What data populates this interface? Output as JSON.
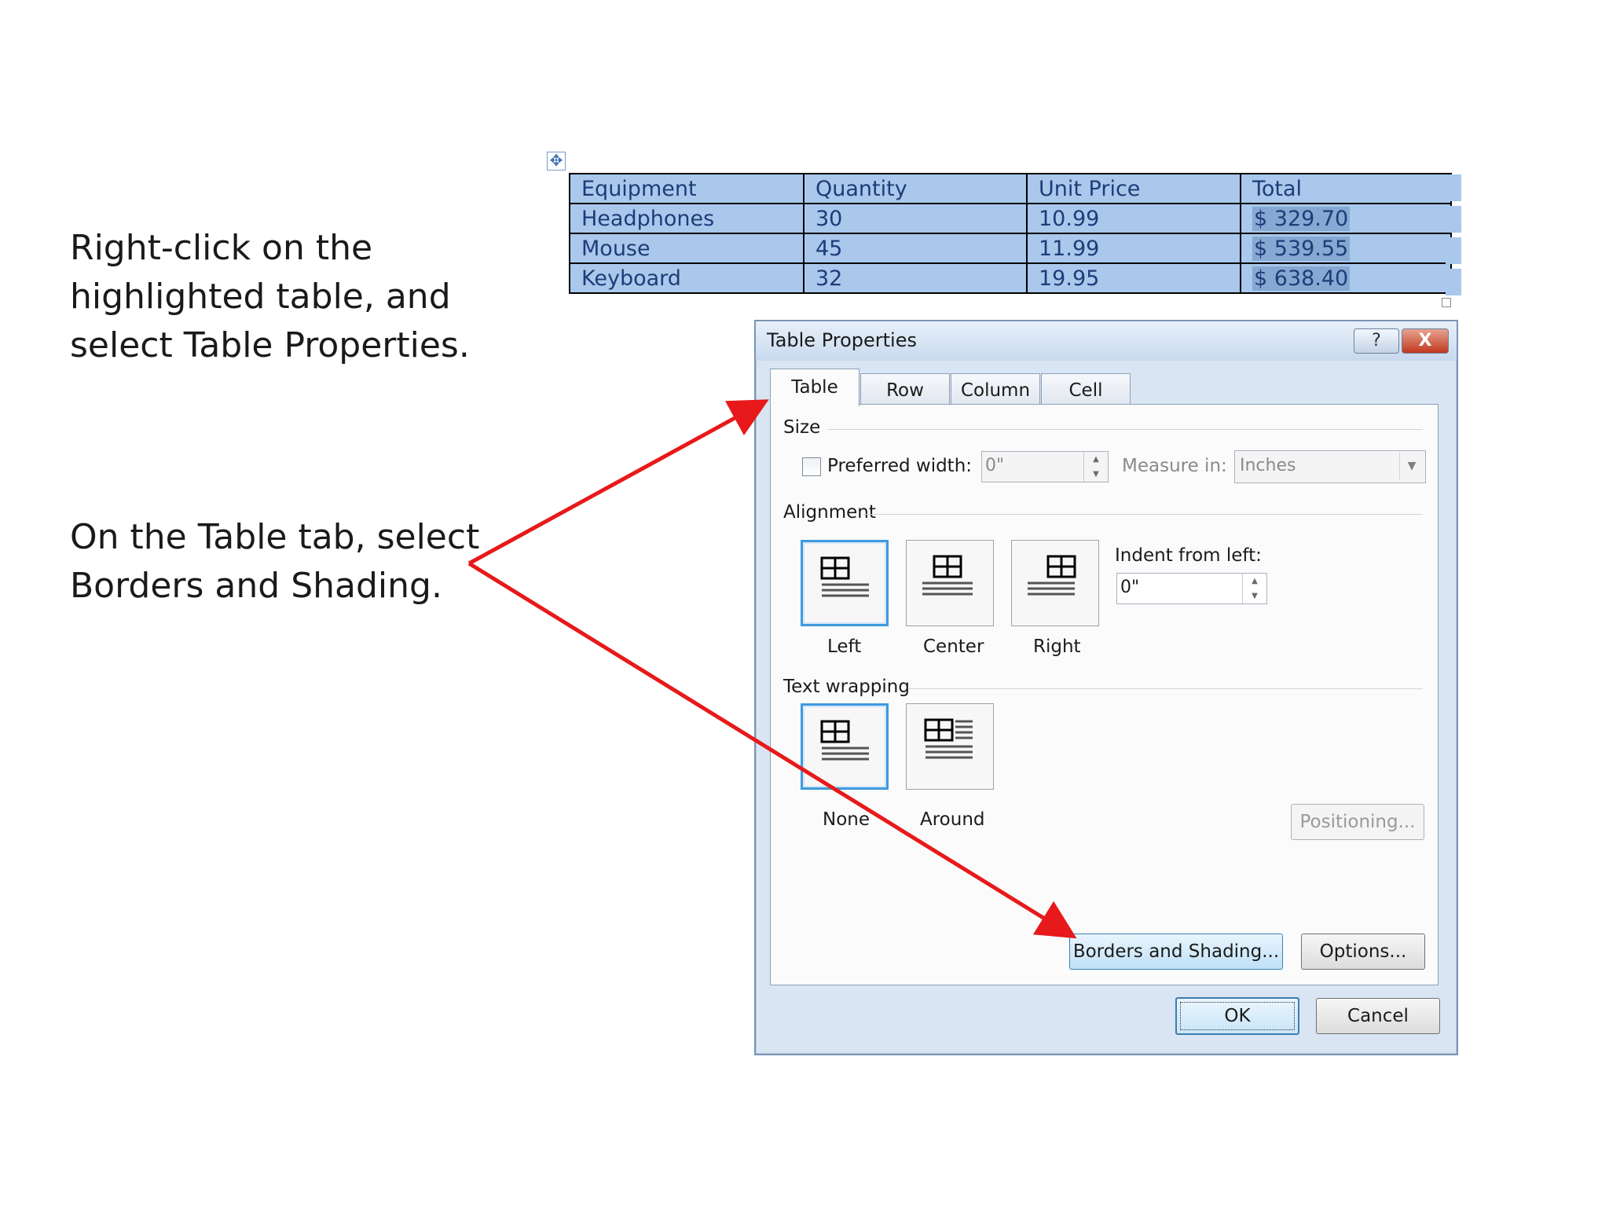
{
  "instructions": {
    "step1_lines": [
      "Right-click on the",
      "highlighted table, and",
      "select Table Properties."
    ],
    "step2_lines": [
      "On the Table tab, select",
      "Borders and Shading."
    ]
  },
  "table": {
    "move_handle": "move-icon",
    "rows": [
      [
        "Equipment",
        "Quantity",
        "Unit Price",
        "Total"
      ],
      [
        "Headphones",
        "30",
        "10.99",
        "$ 329.70"
      ],
      [
        "Mouse",
        "45",
        "11.99",
        "$ 539.55"
      ],
      [
        "Keyboard",
        "32",
        "19.95",
        "$ 638.40"
      ]
    ],
    "selection_color": "#a9c8ec"
  },
  "dialog": {
    "title": "Table Properties",
    "help_label": "?",
    "close_label": "X",
    "tabs": [
      "Table",
      "Row",
      "Column",
      "Cell"
    ],
    "active_tab": "Table",
    "size": {
      "section_label": "Size",
      "preferred_width_label": "Preferred width:",
      "preferred_width_checked": false,
      "preferred_width_value": "0\"",
      "measure_in_label": "Measure in:",
      "measure_in_value": "Inches"
    },
    "alignment": {
      "section_label": "Alignment",
      "options": [
        "Left",
        "Center",
        "Right"
      ],
      "selected": "Left",
      "indent_label": "Indent from left:",
      "indent_value": "0\""
    },
    "text_wrapping": {
      "section_label": "Text wrapping",
      "options": [
        "None",
        "Around"
      ],
      "selected": "None",
      "positioning_label": "Positioning..."
    },
    "borders_label": "Borders and Shading...",
    "options_label": "Options...",
    "ok_label": "OK",
    "cancel_label": "Cancel"
  },
  "annotation": {
    "arrow_color": "#e8191a"
  }
}
